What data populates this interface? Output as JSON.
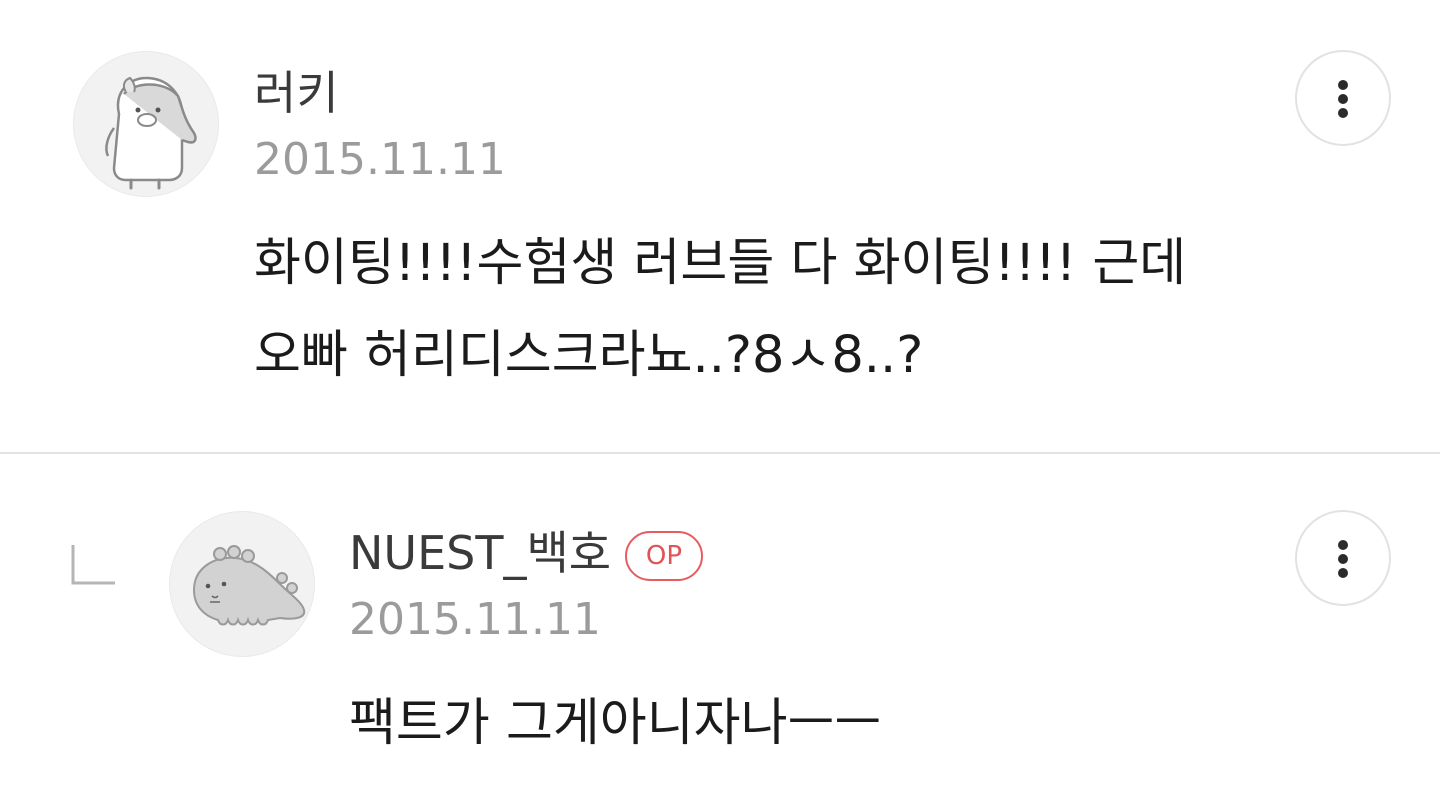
{
  "comments": [
    {
      "author": "러키",
      "date": "2015.11.11",
      "lines": [
        "화이팅!!!!수험생 러브들 다 화이팅!!!! 근데",
        "오빠 허리디스크라뇨..?8ㅅ8..?"
      ],
      "avatar_icon": "penguin-character-icon",
      "is_reply": false
    },
    {
      "author": "NUEST_백호",
      "badge": "OP",
      "date": "2015.11.11",
      "lines": [
        "팩트가 그게아니자나ㅡㅡ"
      ],
      "avatar_icon": "dinosaur-character-icon",
      "is_reply": true
    }
  ],
  "icons": {
    "more": "more-vertical-icon",
    "reply": "reply-arrow-icon"
  },
  "colors": {
    "badge": "#e05358",
    "date": "#9b9b9b",
    "divider": "#e3e3e3"
  }
}
